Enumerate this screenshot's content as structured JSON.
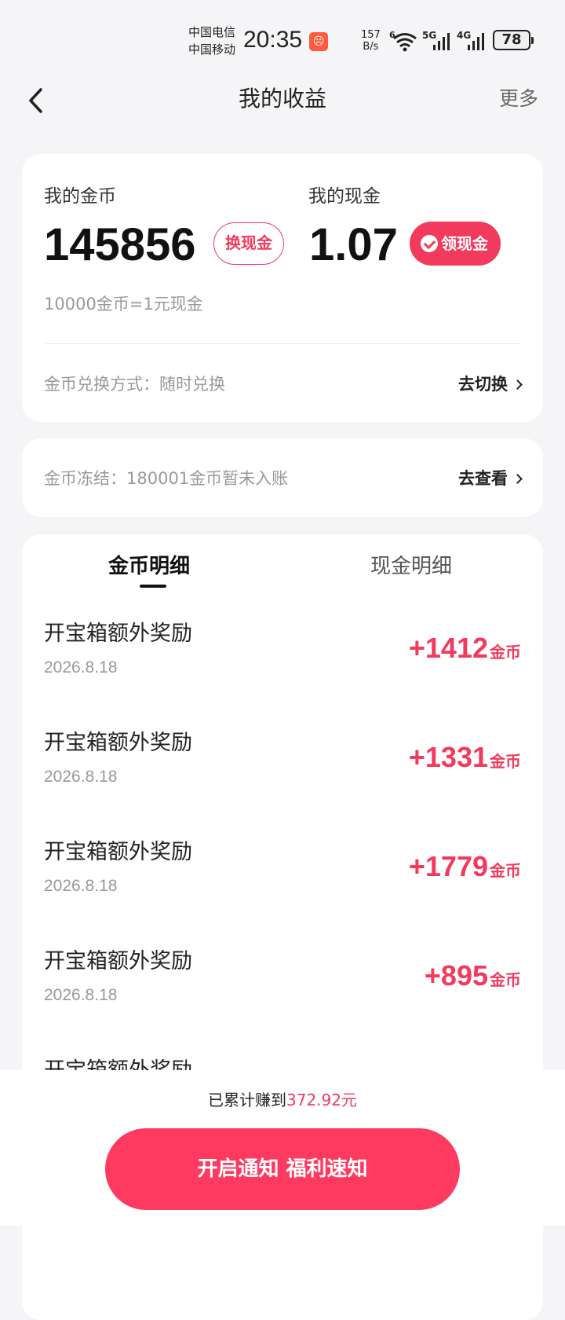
{
  "status_bar": {
    "carrier_1": "中国电信",
    "carrier_2": "中国移动",
    "time": "20:35",
    "net_speed_value": "157",
    "net_speed_unit": "B/s",
    "wifi_tag": "6",
    "signal_1_tag": "5G",
    "signal_2_tag": "4G",
    "battery": "78"
  },
  "header": {
    "title": "我的收益",
    "more": "更多"
  },
  "balance": {
    "coins_label": "我的金币",
    "coins_value": "145856",
    "exchange_button": "换现金",
    "cash_label": "我的现金",
    "cash_value": "1.07",
    "withdraw_button": "领现金",
    "rate_text": "10000金币=1元现金",
    "method_text": "金币兑换方式：随时兑换",
    "switch_link": "去切换"
  },
  "frozen": {
    "text": "金币冻结：180001金币暂未入账",
    "link": "去查看"
  },
  "tabs": [
    {
      "label": "金币明细",
      "active": true
    },
    {
      "label": "现金明细",
      "active": false
    }
  ],
  "records": [
    {
      "title": "开宝箱额外奖励",
      "date": "2026.8.18",
      "amount": "+1412",
      "unit": "金币"
    },
    {
      "title": "开宝箱额外奖励",
      "date": "2026.8.18",
      "amount": "+1331",
      "unit": "金币"
    },
    {
      "title": "开宝箱额外奖励",
      "date": "2026.8.18",
      "amount": "+1779",
      "unit": "金币"
    },
    {
      "title": "开宝箱额外奖励",
      "date": "2026.8.18",
      "amount": "+895",
      "unit": "金币"
    },
    {
      "title": "开宝箱额外奖励",
      "date": "",
      "amount": "",
      "unit": ""
    }
  ],
  "bottom": {
    "earned_prefix": "已累计赚到",
    "earned_amount": "372.92元",
    "cta": "开启通知 福利速知"
  },
  "colors": {
    "accent": "#f23a5c",
    "cta": "#fe3a60",
    "background": "#f5f5f7"
  }
}
